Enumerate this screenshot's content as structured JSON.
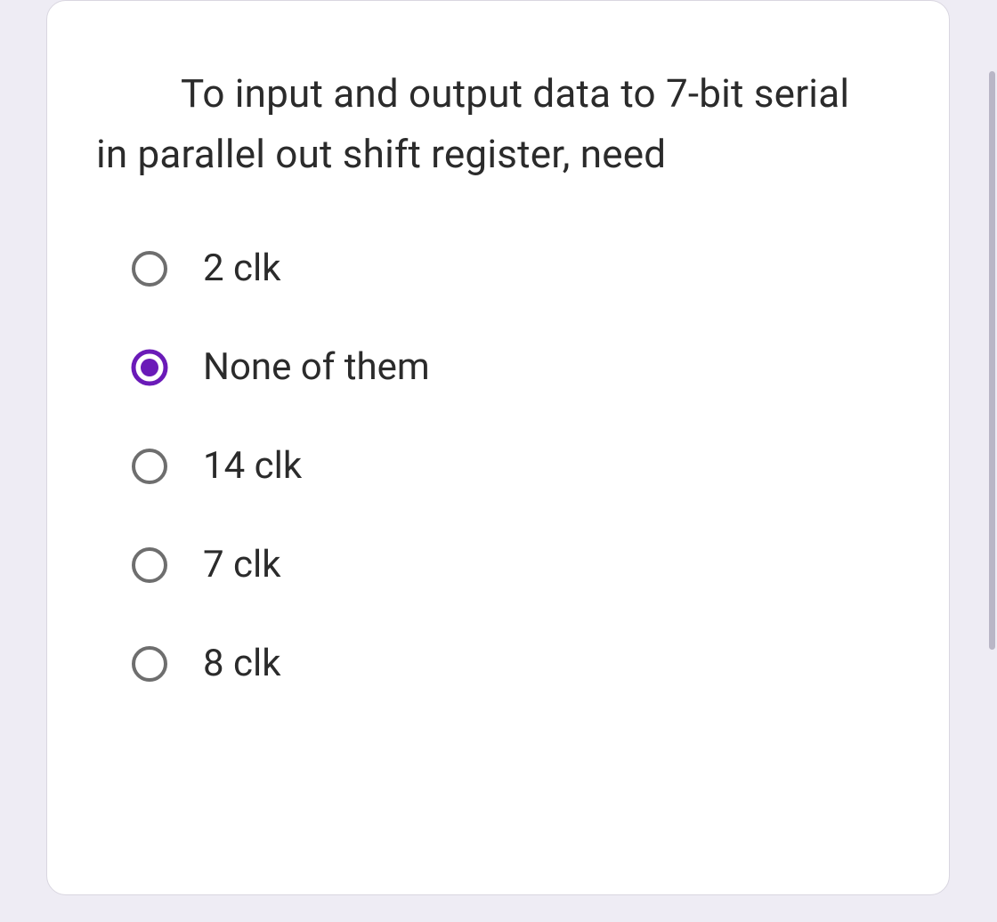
{
  "colors": {
    "accent": "#6a1ab8",
    "ring_unselected": "#6e6e6e",
    "text": "#2b2b2b",
    "card_bg": "#ffffff",
    "page_bg": "#eeecf4"
  },
  "question": {
    "text": "To input  and output data to 7-bit serial in parallel out shift register, need"
  },
  "options": [
    {
      "label": "2 clk",
      "selected": false
    },
    {
      "label": "None of them",
      "selected": true
    },
    {
      "label": "14 clk",
      "selected": false
    },
    {
      "label": "7 clk",
      "selected": false
    },
    {
      "label": "8 clk",
      "selected": false
    }
  ]
}
